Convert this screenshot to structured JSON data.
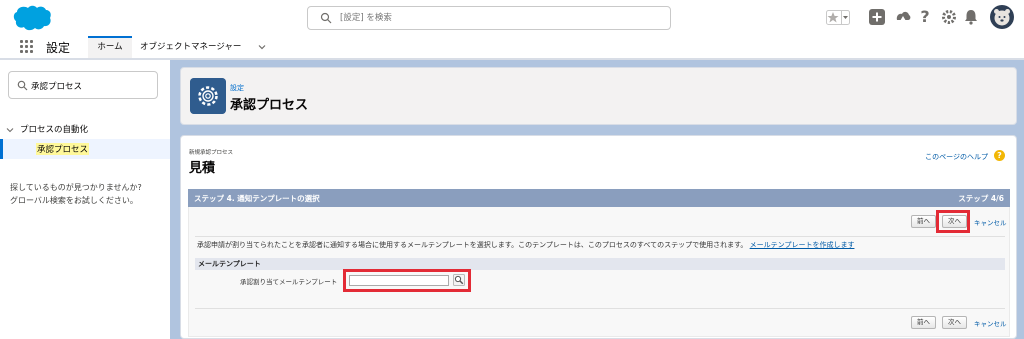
{
  "header": {
    "search_placeholder": "[設定] を検索"
  },
  "nav": {
    "app_name": "設定",
    "tabs": [
      {
        "label": "ホーム",
        "active": true
      },
      {
        "label": "オブジェクトマネージャー",
        "active": false
      }
    ]
  },
  "sidebar": {
    "quick_find_value": "承認プロセス",
    "group_label": "プロセスの自動化",
    "selected_item": "承認プロセス",
    "help_text_line1": "探しているものが見つかりませんか?",
    "help_text_line2": "グローバル検索をお試しください。"
  },
  "page_header": {
    "breadcrumb": "設定",
    "title": "承認プロセス"
  },
  "wizard": {
    "subtitle": "新規承認プロセス",
    "title": "見積",
    "help_link": "このページのヘルプ",
    "step_title": "ステップ 4. 通知テンプレートの選択",
    "step_count": "ステップ 4/6",
    "prev_label": "前へ",
    "next_label": "次へ",
    "cancel_label": "キャンセル",
    "description": "承認申請が割り当てられたことを承認者に通知する場合に使用するメールテンプレートを選択します。このテンプレートは、このプロセスのすべてのステップで使用されます。",
    "create_template_link": "メールテンプレートを作成します",
    "section_title": "メールテンプレート",
    "field_label": "承認割り当てメールテンプレート",
    "field_value": ""
  },
  "colors": {
    "brand_blue": "#0070d2",
    "step_bar": "#8a9ebe",
    "highlight": "#e32b36",
    "background": "#b0c4df"
  }
}
